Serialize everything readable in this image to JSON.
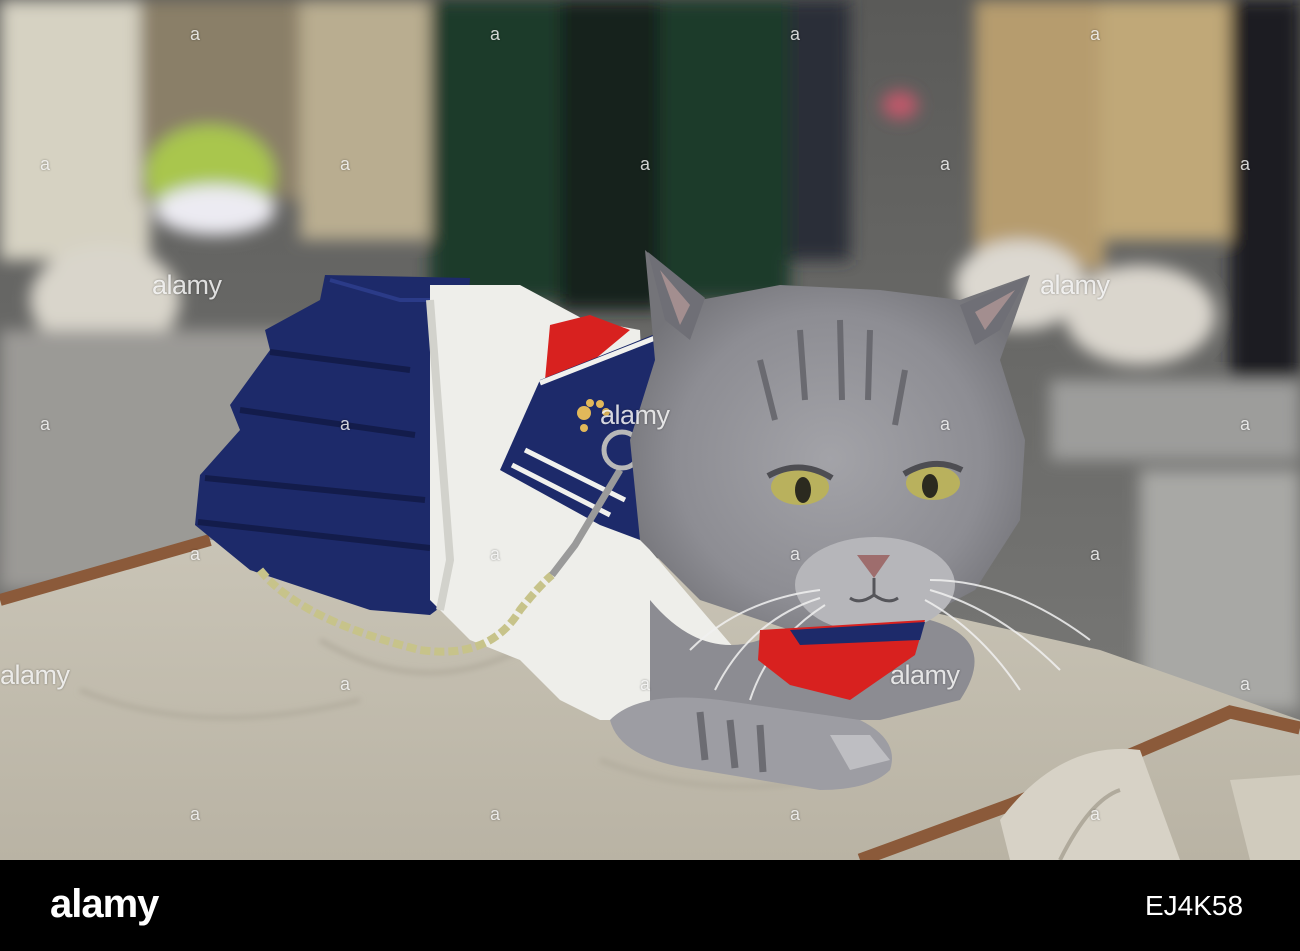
{
  "watermark": {
    "text": "alamy",
    "brand_text": "alamy",
    "image_id": "EJ4K58",
    "marks": [
      "a",
      "a",
      "a",
      "a",
      "a",
      "a",
      "a",
      "a",
      "a",
      "a",
      "a",
      "a",
      "a",
      "a",
      "a",
      "a",
      "a",
      "a",
      "a",
      "a",
      "a",
      "a",
      "a",
      "a",
      "a",
      "a",
      "a",
      "a"
    ]
  },
  "colors": {
    "uniform_navy": "#1d2a6a",
    "uniform_white": "#eeeeea",
    "collar_red": "#d8211f",
    "cat_grey": "#8f8f95",
    "blanket": "#cdc8ba",
    "blanket_trim": "#8b5a3a"
  }
}
